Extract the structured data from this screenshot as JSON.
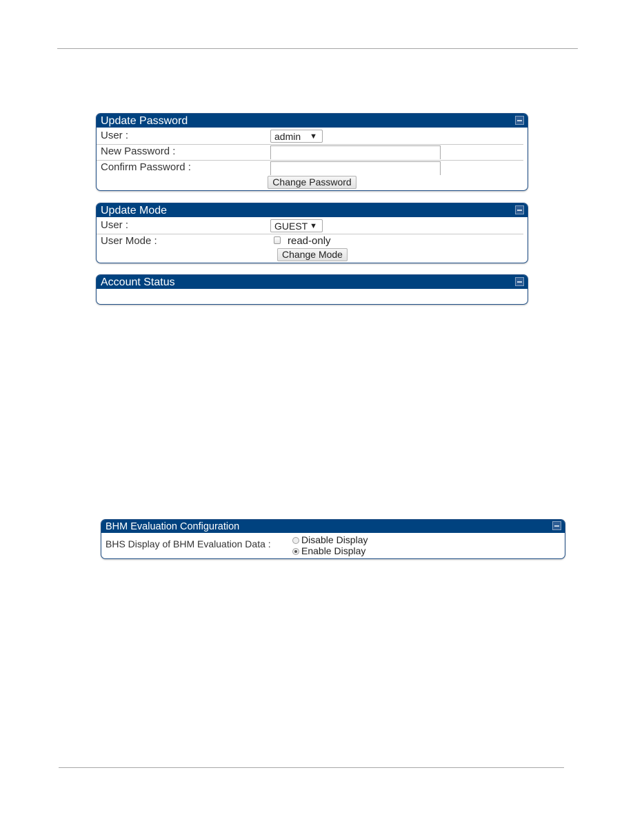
{
  "update_password": {
    "title": "Update Password",
    "user_label": "User :",
    "user_value": "admin",
    "new_password_label": "New Password :",
    "new_password_value": "",
    "confirm_password_label": "Confirm Password :",
    "confirm_password_value": "",
    "button_label": "Change Password"
  },
  "update_mode": {
    "title": "Update Mode",
    "user_label": "User :",
    "user_value": "GUEST",
    "user_mode_label": "User Mode :",
    "read_only_label": "read-only",
    "read_only_checked": false,
    "button_label": "Change Mode"
  },
  "account_status": {
    "title": "Account Status"
  },
  "bhm_evaluation": {
    "title": "BHM Evaluation Configuration",
    "field_label": "BHS Display of BHM Evaluation Data :",
    "options": [
      {
        "label": "Disable Display",
        "selected": false
      },
      {
        "label": "Enable Display",
        "selected": true
      }
    ]
  },
  "icons": {
    "collapse": "collapse-icon",
    "dropdown": "▼"
  },
  "colors": {
    "panel_header": "#00427f",
    "panel_border": "#1f4e85"
  }
}
